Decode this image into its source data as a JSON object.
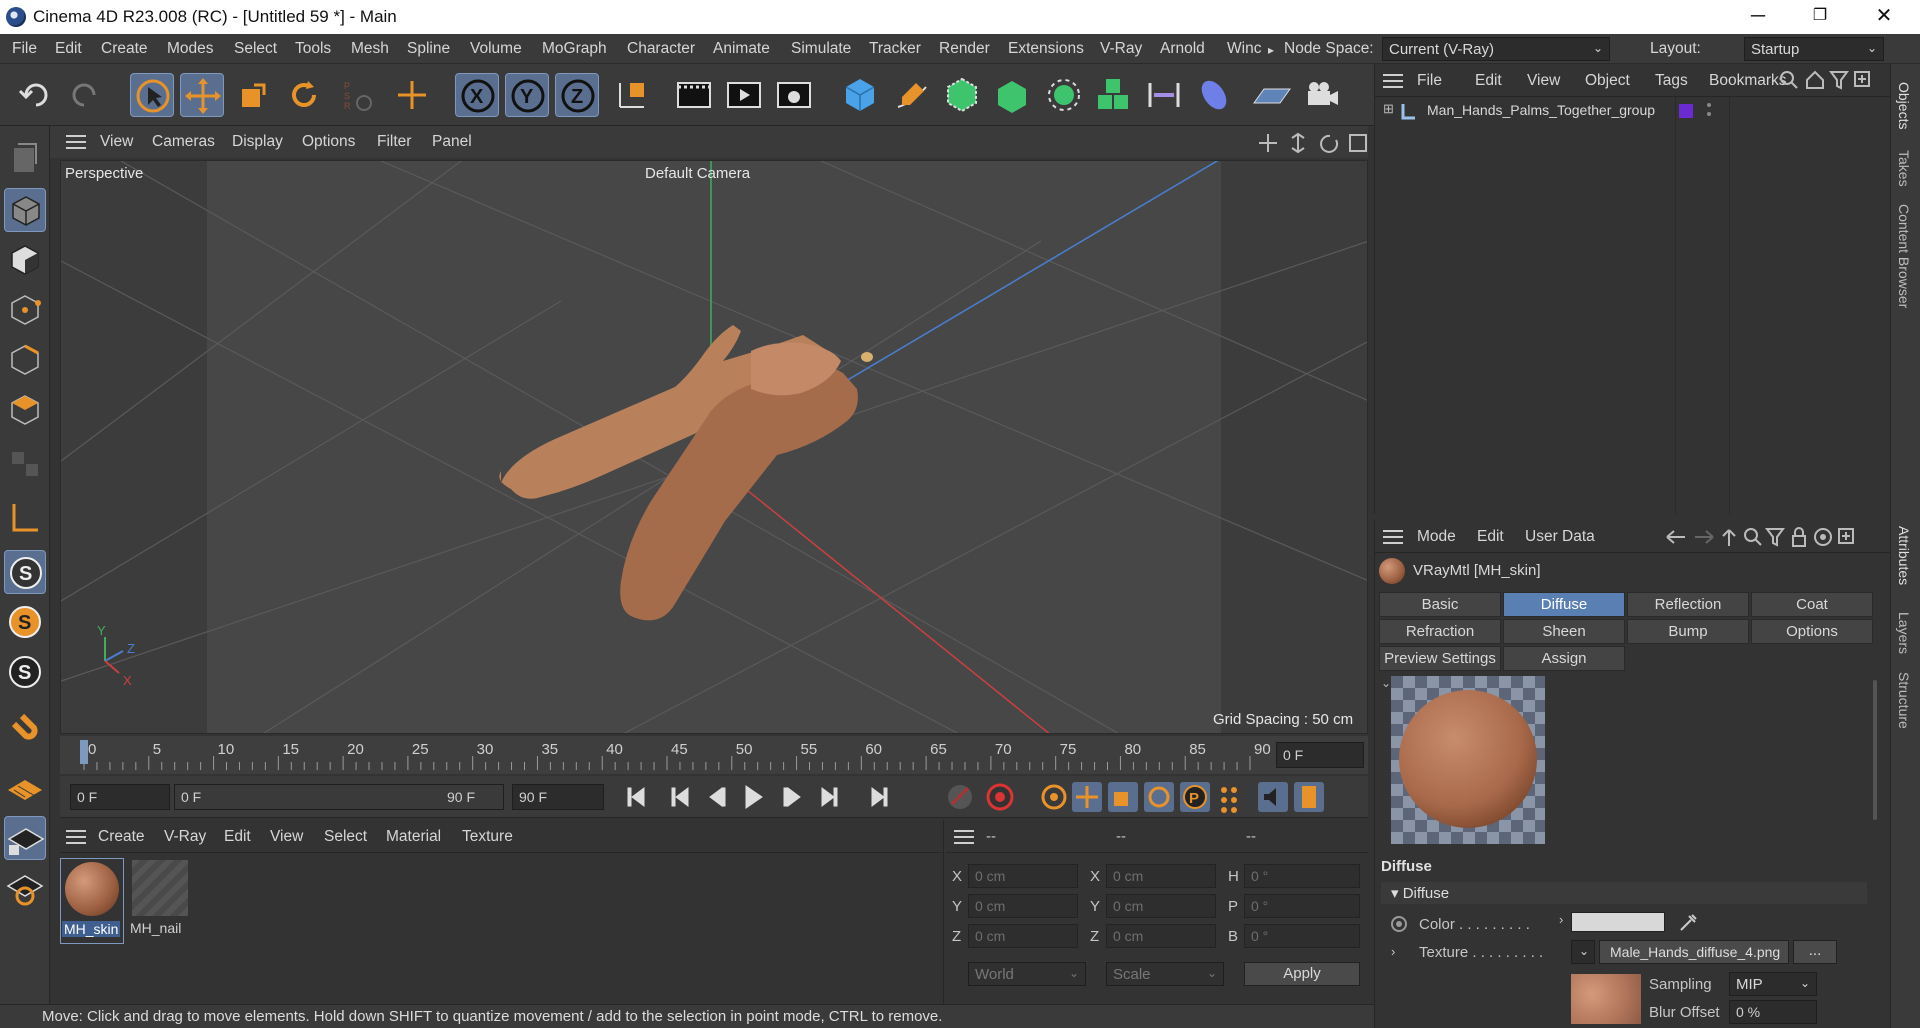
{
  "window": {
    "title": "Cinema 4D R23.008 (RC) - [Untitled 59 *] - Main",
    "min": "─",
    "max": "❐",
    "close": "✕"
  },
  "menu": {
    "items": [
      "File",
      "Edit",
      "Create",
      "Modes",
      "Select",
      "Tools",
      "Mesh",
      "Spline",
      "Volume",
      "MoGraph",
      "Character",
      "Animate",
      "Simulate",
      "Tracker",
      "Render",
      "Extensions",
      "V-Ray",
      "Arnold",
      "Winc"
    ],
    "overflow": "▸",
    "node_space_label": "Node Space:",
    "node_space_value": "Current (V-Ray)",
    "layout_label": "Layout:",
    "layout_value": "Startup"
  },
  "viewport": {
    "menu": [
      "View",
      "Cameras",
      "Display",
      "Options",
      "Filter",
      "Panel"
    ],
    "name": "Perspective",
    "camera": "Default Camera",
    "grid_spacing": "Grid Spacing : 50 cm",
    "axis_x": "X",
    "axis_y": "Y",
    "axis_z": "Z"
  },
  "timeline": {
    "ticks": [
      "0",
      "5",
      "10",
      "15",
      "20",
      "25",
      "30",
      "35",
      "40",
      "45",
      "50",
      "55",
      "60",
      "65",
      "70",
      "75",
      "80",
      "85",
      "90"
    ],
    "current_frame": "0 F"
  },
  "transport": {
    "start": "0 F",
    "range_start": "0 F",
    "range_end": "90 F",
    "end": "90 F"
  },
  "material_manager": {
    "menu": [
      "Create",
      "V-Ray",
      "Edit",
      "View",
      "Select",
      "Material",
      "Texture"
    ],
    "materials": [
      "MH_skin",
      "MH_nail"
    ]
  },
  "coords": {
    "headers": [
      "--",
      "--",
      "--"
    ],
    "rows": [
      {
        "a": "X",
        "av": "0 cm",
        "b": "X",
        "bv": "0 cm",
        "c": "H",
        "cv": "0 °"
      },
      {
        "a": "Y",
        "av": "0 cm",
        "b": "Y",
        "bv": "0 cm",
        "c": "P",
        "cv": "0 °"
      },
      {
        "a": "Z",
        "av": "0 cm",
        "b": "Z",
        "bv": "0 cm",
        "c": "B",
        "cv": "0 °"
      }
    ],
    "world": "World",
    "scale": "Scale",
    "apply": "Apply"
  },
  "object_manager": {
    "menu": [
      "File",
      "Edit",
      "View",
      "Object",
      "Tags",
      "Bookmarks"
    ],
    "object_name": "Man_Hands_Palms_Together_group",
    "tag_color": "#6a2bd0"
  },
  "attributes": {
    "menu": [
      "Mode",
      "Edit",
      "User Data"
    ],
    "material_title": "VRayMtl [MH_skin]",
    "tabs_row1": [
      "Basic",
      "Diffuse",
      "Reflection",
      "Coat"
    ],
    "tabs_row2": [
      "Refraction",
      "Sheen",
      "Bump",
      "Options"
    ],
    "tabs_row3": [
      "Preview Settings",
      "Assign"
    ],
    "section": "Diffuse",
    "group": "Diffuse",
    "color_label": "Color . . . . . . . . .",
    "texture_label": "Texture . . . . . . . . .",
    "texture_file": "Male_Hands_diffuse_4.png",
    "dots": "...",
    "sampling_label": "Sampling",
    "sampling_value": "MIP",
    "blur_label": "Blur Offset",
    "blur_value": "0 %"
  },
  "side_tabs": [
    "Objects",
    "Takes",
    "Content Browser",
    "Attributes",
    "Layers",
    "Structure"
  ],
  "status": "Move: Click and drag to move elements. Hold down SHIFT to quantize movement / add to the selection in point mode, CTRL to remove.",
  "colors": {
    "accent": "#5a7fb3",
    "orange": "#e8922a",
    "x_axis": "#c94040",
    "y_axis": "#3fae5e",
    "z_axis": "#4a7fd0"
  }
}
